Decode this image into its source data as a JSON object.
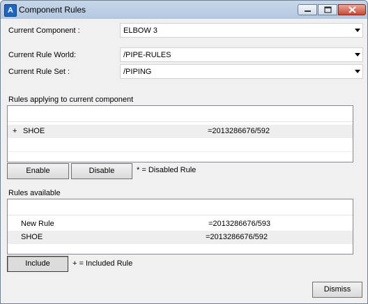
{
  "window": {
    "title": "Component Rules",
    "app_icon_letter": "A"
  },
  "form": {
    "current_component_label": "Current Component :",
    "current_component_value": "ELBOW 3",
    "current_rule_world_label": "Current Rule World:",
    "current_rule_world_value": "/PIPE-RULES",
    "current_rule_set_label": "Current Rule Set  :",
    "current_rule_set_value": "/PIPING"
  },
  "applying": {
    "section_label": "Rules applying to current component",
    "rows": [
      {
        "marker": "+",
        "name": "SHOE",
        "ref": "=2013286676/592"
      }
    ],
    "enable_label": "Enable",
    "disable_label": "Disable",
    "legend": "* = Disabled Rule"
  },
  "available": {
    "section_label": "Rules available",
    "rows": [
      {
        "name": "New Rule",
        "ref": "=2013286676/593"
      },
      {
        "name": "SHOE",
        "ref": "=2013286676/592"
      }
    ],
    "include_label": "Include",
    "legend": "+ = Included Rule"
  },
  "dismiss_label": "Dismiss",
  "icons": {
    "app": "app-icon",
    "minimize": "minimize-icon",
    "maximize": "maximize-icon",
    "close": "close-icon",
    "dropdown": "chevron-down-icon"
  },
  "colors": {
    "titlebar": "#b3c8e0",
    "close_button": "#c74a34",
    "client_bg": "#f0f0f0",
    "row_shade": "#eeeeee"
  }
}
